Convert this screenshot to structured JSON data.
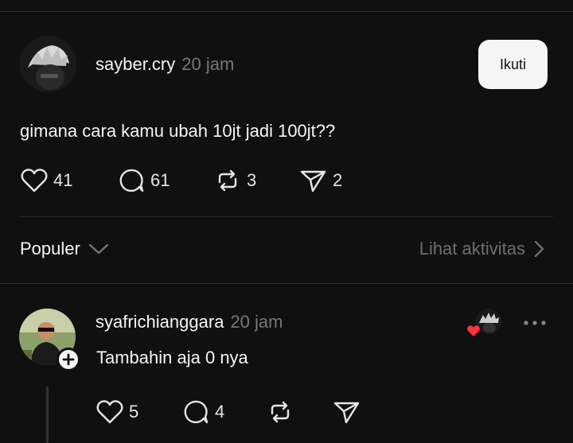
{
  "post": {
    "username": "sayber.cry",
    "time": "20 jam",
    "follow_label": "Ikuti",
    "text": "gimana cara kamu ubah 10jt jadi 100jt??",
    "likes": "41",
    "comments": "61",
    "reposts": "3",
    "shares": "2"
  },
  "replies_bar": {
    "sort_label": "Populer",
    "activity_label": "Lihat aktivitas"
  },
  "reply": {
    "username": "syafrichianggara",
    "time": "20 jam",
    "text": "Tambahin aja 0 nya",
    "likes": "5",
    "comments": "4"
  },
  "colors": {
    "background": "#101010",
    "text": "#f3f5f7",
    "muted": "#777777",
    "heart_red": "#ff3040",
    "follow_button_bg": "#f5f5f5"
  }
}
